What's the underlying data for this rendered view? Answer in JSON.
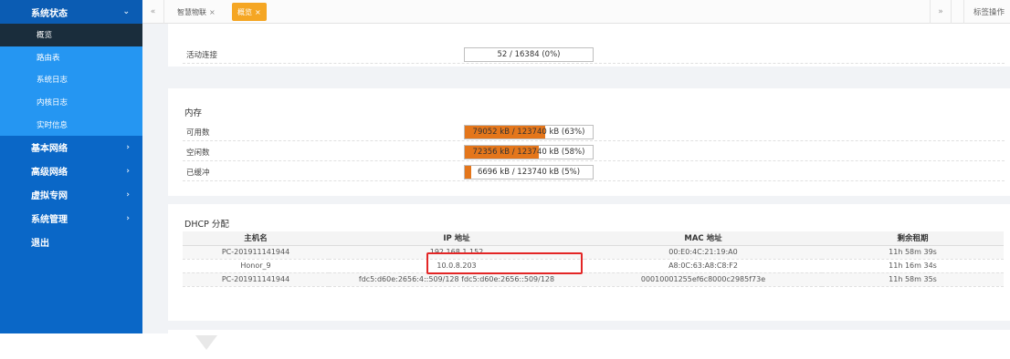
{
  "sidebar": {
    "groups": [
      {
        "label": "系统状态",
        "icon": "chevron-down-icon"
      },
      {
        "label": "基本网络",
        "icon": "chevron-right-icon"
      },
      {
        "label": "高级网络",
        "icon": "chevron-right-icon"
      },
      {
        "label": "虚拟专网",
        "icon": "chevron-right-icon"
      },
      {
        "label": "系统管理",
        "icon": "chevron-right-icon"
      },
      {
        "label": "退出"
      }
    ],
    "status_items": [
      "概览",
      "路由表",
      "系统日志",
      "内核日志",
      "实时信息"
    ],
    "arrow_down": "⌄",
    "arrow_right": "›"
  },
  "tabs": {
    "prev": "«",
    "next": "»",
    "items": [
      {
        "label": "智慧物联",
        "close": "×"
      },
      {
        "label": "概览",
        "close": "×"
      }
    ],
    "ops_label": "标签操作"
  },
  "connections": {
    "label": "活动连接",
    "value": "52 / 16384 (0%)",
    "percent": 0
  },
  "memory": {
    "title": "内存",
    "rows": [
      {
        "label": "可用数",
        "value": "79052 kB / 123740 kB (63%)",
        "percent": 63
      },
      {
        "label": "空闲数",
        "value": "72356 kB / 123740 kB (58%)",
        "percent": 58
      },
      {
        "label": "已缓冲",
        "value": "6696 kB / 123740 kB (5%)",
        "percent": 5
      }
    ]
  },
  "dhcp": {
    "title": "DHCP 分配",
    "headers": [
      "主机名",
      "IP 地址",
      "MAC 地址",
      "剩余租期"
    ],
    "rows": [
      [
        "PC-201911141944",
        "192.168.1.152",
        "00:E0:4C:21:19:A0",
        "11h 58m 39s"
      ],
      [
        "Honor_9",
        "10.0.8.203",
        "A8:0C:63:A8:C8:F2",
        "11h 16m 34s"
      ],
      [
        "PC-201911141944",
        "fdc5:d60e:2656:4::509/128 fdc5:d60e:2656::509/128",
        "00010001255ef6c8000c2985f73e",
        "11h 58m 35s"
      ]
    ]
  },
  "colors": {
    "sidebar": "#0a67c7",
    "submenu": "#2596f2",
    "active_item": "#1a2d3c",
    "tab_active": "#f5a623",
    "bar_fill": "#e4761b",
    "highlight": "#e32626"
  }
}
